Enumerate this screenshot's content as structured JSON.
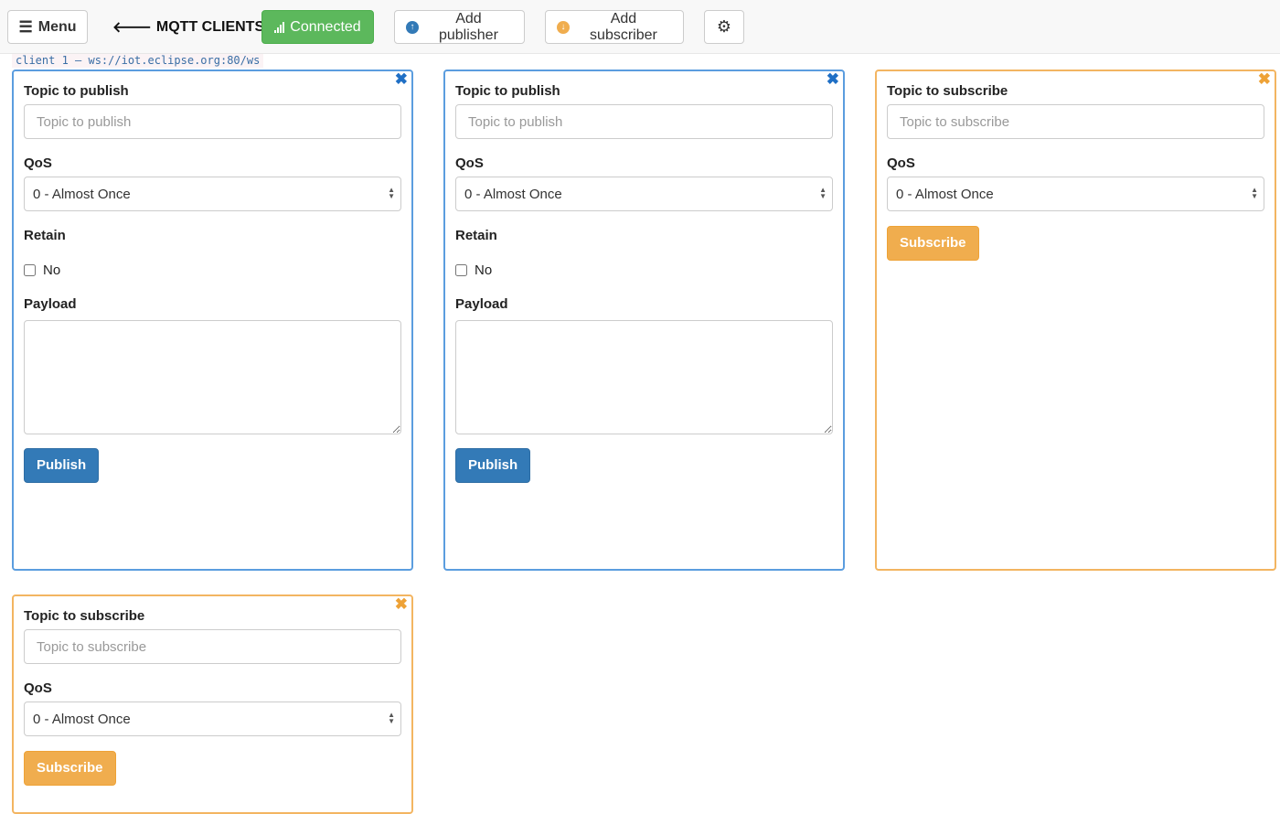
{
  "navbar": {
    "menu_label": "Menu",
    "menu_icon": "hamburger-icon",
    "brand_label": "MQTT CLIENTS",
    "brand_icon": "arrow-left-icon",
    "connected_label": "Connected",
    "connected_icon": "signal-icon",
    "add_publisher_label": "Add publisher",
    "add_publisher_icon": "arrow-circle-up-icon",
    "add_subscriber_label": "Add subscriber",
    "add_subscriber_icon": "arrow-circle-down-icon",
    "settings_icon": "gear-icon"
  },
  "client_label": "client 1 – ws://iot.eclipse.org:80/ws",
  "colors": {
    "publisher_border": "#5b9ddf",
    "subscriber_border": "#f3b561",
    "connected": "#5cb85c",
    "primary": "#337ab7",
    "warning": "#f0ad4e"
  },
  "publishers": [
    {
      "topic_label": "Topic to publish",
      "topic_placeholder": "Topic to publish",
      "topic_value": "",
      "qos_label": "QoS",
      "qos_value": "0 - Almost Once",
      "retain_label": "Retain",
      "retain_checked": false,
      "retain_option": "No",
      "payload_label": "Payload",
      "payload_value": "",
      "button_label": "Publish"
    },
    {
      "topic_label": "Topic to publish",
      "topic_placeholder": "Topic to publish",
      "topic_value": "",
      "qos_label": "QoS",
      "qos_value": "0 - Almost Once",
      "retain_label": "Retain",
      "retain_checked": false,
      "retain_option": "No",
      "payload_label": "Payload",
      "payload_value": "",
      "button_label": "Publish"
    }
  ],
  "subscribers": [
    {
      "topic_label": "Topic to subscribe",
      "topic_placeholder": "Topic to subscribe",
      "topic_value": "",
      "qos_label": "QoS",
      "qos_value": "0 - Almost Once",
      "button_label": "Subscribe"
    },
    {
      "topic_label": "Topic to subscribe",
      "topic_placeholder": "Topic to subscribe",
      "topic_value": "",
      "qos_label": "QoS",
      "qos_value": "0 - Almost Once",
      "button_label": "Subscribe"
    }
  ],
  "close_glyph": "✖"
}
